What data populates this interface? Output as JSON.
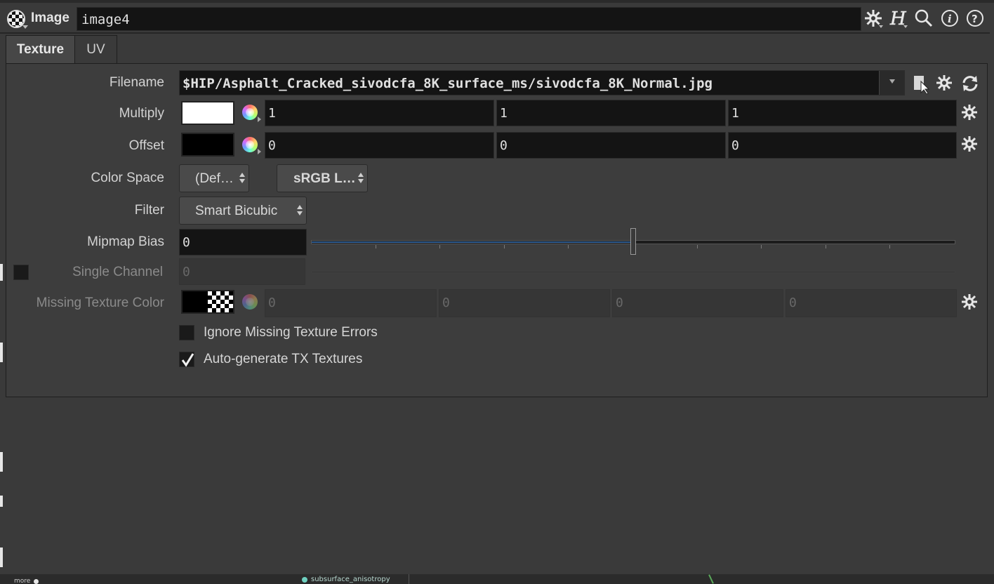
{
  "header": {
    "node_type": "Image",
    "node_name": "image4",
    "icons": [
      "gear-icon",
      "houdini-h-icon",
      "search-icon",
      "info-icon",
      "help-icon"
    ]
  },
  "tabs": [
    {
      "label": "Texture",
      "active": true
    },
    {
      "label": "UV",
      "active": false
    }
  ],
  "params": {
    "filename": {
      "label": "Filename",
      "value": "$HIP/Asphalt_Cracked_sivodcfa_8K_surface_ms/sivodcfa_8K_Normal.jpg"
    },
    "multiply": {
      "label": "Multiply",
      "values": [
        "1",
        "1",
        "1"
      ],
      "swatch_color": "#ffffff"
    },
    "offset": {
      "label": "Offset",
      "values": [
        "0",
        "0",
        "0"
      ],
      "swatch_color": "#000000"
    },
    "color_space": {
      "label": "Color Space",
      "option1": "(Def…",
      "option2": "sRGB L…"
    },
    "filter": {
      "label": "Filter",
      "value": "Smart Bicubic"
    },
    "mipmap_bias": {
      "label": "Mipmap Bias",
      "value": "0",
      "slider_fraction": 0.5
    },
    "single_channel": {
      "label": "Single Channel",
      "value": "0",
      "enabled": false
    },
    "missing_texture_color": {
      "label": "Missing Texture Color",
      "values": [
        "0",
        "0",
        "0",
        "0"
      ]
    },
    "ignore_missing": {
      "label": "Ignore Missing Texture Errors",
      "checked": false
    },
    "auto_tx": {
      "label": "Auto-generate TX Textures",
      "checked": true
    }
  },
  "bottom": {
    "network_node_label": "subsurface_anisotropy",
    "more_label": "more"
  },
  "colors": {
    "accent": "#2e5a8e",
    "field_bg": "#141414",
    "panel_bg": "#3d3d3d"
  }
}
